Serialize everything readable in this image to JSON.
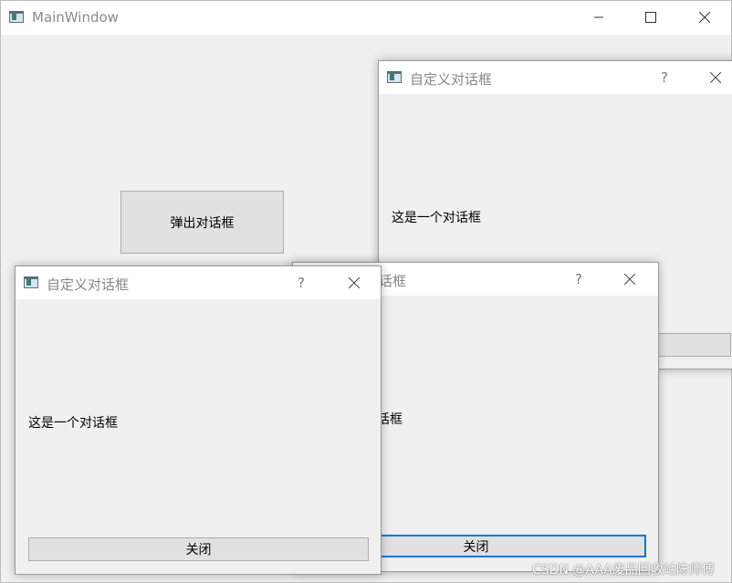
{
  "main_window": {
    "title": "MainWindow",
    "popup_button_label": "弹出对话框"
  },
  "dialogs": [
    {
      "title": "自定义对话框",
      "help_symbol": "?",
      "message": "这是一个对话框",
      "close_button_label": ""
    },
    {
      "title": "话框",
      "help_symbol": "?",
      "message": "话框",
      "close_button_label": "关闭"
    },
    {
      "title": "自定义对话框",
      "help_symbol": "?",
      "message": "这是一个对话框",
      "close_button_label": "关闭"
    }
  ],
  "watermark": "CSDN @AAA废品回收站陈师傅",
  "colors": {
    "title_text": "#888888",
    "window_body": "#f0f0f0",
    "focus_border": "#0078d7"
  }
}
